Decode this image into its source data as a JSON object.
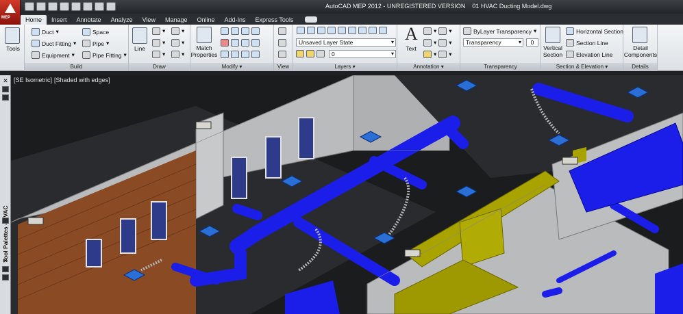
{
  "window": {
    "title": "AutoCAD MEP 2012 - UNREGISTERED VERSION",
    "document": "01 HVAC Ducting Model.dwg",
    "app_badge": "MEP"
  },
  "tabs": [
    {
      "label": "Home",
      "active": true
    },
    {
      "label": "Insert"
    },
    {
      "label": "Annotate"
    },
    {
      "label": "Analyze"
    },
    {
      "label": "View"
    },
    {
      "label": "Manage"
    },
    {
      "label": "Online"
    },
    {
      "label": "Add-Ins"
    },
    {
      "label": "Express Tools"
    }
  ],
  "ribbon": {
    "tools_label": "Tools",
    "build": {
      "label": "Build",
      "duct": "Duct",
      "duct_fitting": "Duct Fitting",
      "equipment": "Equipment",
      "space": "Space",
      "pipe": "Pipe",
      "pipe_fitting": "Pipe Fitting"
    },
    "draw": {
      "label": "Draw",
      "line": "Line"
    },
    "modify": {
      "label": "Modify",
      "match_properties_1": "Match",
      "match_properties_2": "Properties"
    },
    "view": {
      "label": "View"
    },
    "layers": {
      "label": "Layers",
      "layer_state": "Unsaved Layer State",
      "current_layer": "0"
    },
    "annotation": {
      "label": "Annotation",
      "text": "Text"
    },
    "transparency": {
      "label": "Transparency",
      "bylayer": "ByLayer Transparency",
      "transparency_field": "Transparency",
      "value": "0"
    },
    "section": {
      "label": "Section & Elevation",
      "vertical_section_1": "Vertical",
      "vertical_section_2": "Section",
      "horizontal_section": "Horizontal Section",
      "section_line": "Section Line",
      "elevation_line": "Elevation Line"
    },
    "details": {
      "label": "Details",
      "detail_components_1": "Detail",
      "detail_components_2": "Components"
    }
  },
  "viewport": {
    "view": "[SE Isometric]",
    "style": "[Shaded with edges]"
  },
  "palette": {
    "title": "Tool Palettes - HVAC",
    "close_glyph": "✕"
  },
  "colors": {
    "duct_blue": "#1a1ee8",
    "duct_yellow": "#a9a300",
    "wall_gray": "#b9bbbc",
    "floor_dark": "#2a2b2e",
    "brick": "#8a4a24",
    "diffuser": "#2a6fd6"
  }
}
